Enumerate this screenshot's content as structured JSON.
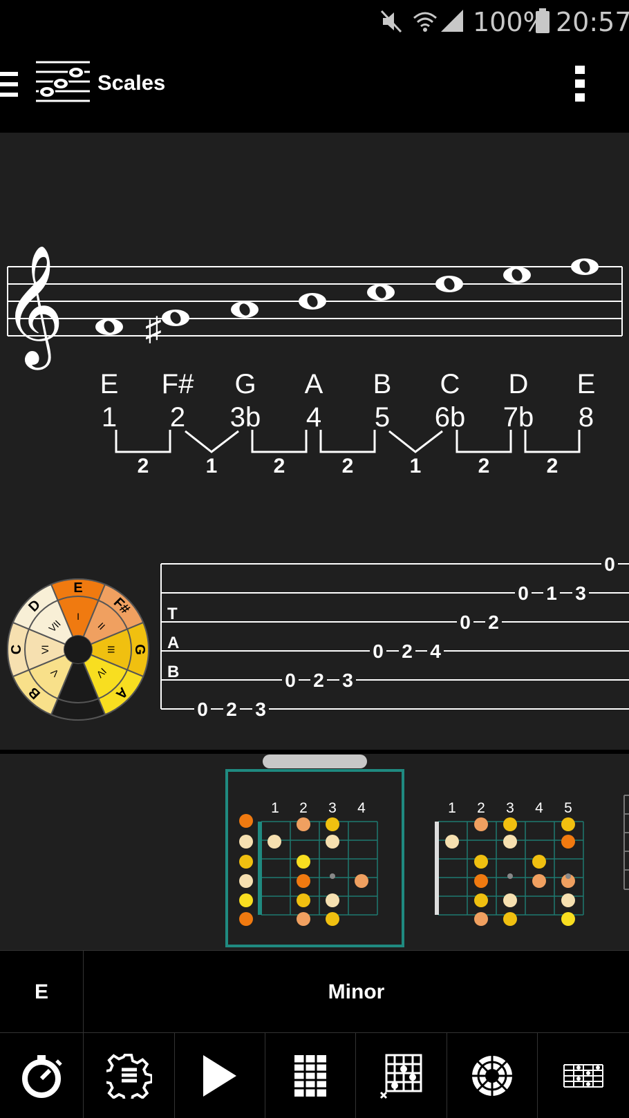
{
  "status": {
    "battery": "100%",
    "time": "20:57"
  },
  "app": {
    "title": "Scales"
  },
  "scale": {
    "notes": [
      "E",
      "F#",
      "G",
      "A",
      "B",
      "C",
      "D",
      "E"
    ],
    "degrees": [
      "1",
      "2",
      "3b",
      "4",
      "5",
      "6b",
      "7b",
      "8"
    ],
    "intervals": [
      "2",
      "1",
      "2",
      "2",
      "1",
      "2",
      "2"
    ],
    "accidental": "♯"
  },
  "wheel": {
    "labels": [
      "E",
      "F#",
      "G",
      "A",
      "",
      "B",
      "C",
      "D"
    ],
    "numerals": [
      "I",
      "II",
      "III",
      "IV",
      "V",
      "VI",
      "VII"
    ]
  },
  "tab": {
    "clef": [
      "T",
      "A",
      "B"
    ],
    "strings": [
      [
        "0"
      ],
      [
        "0",
        "1",
        "3"
      ],
      [
        "0",
        "2"
      ],
      [
        "0",
        "2",
        "4"
      ],
      [
        "0",
        "2",
        "3"
      ],
      [
        "0",
        "2",
        "3"
      ]
    ]
  },
  "fretboards": {
    "first_frets": [
      "1",
      "2",
      "3",
      "4"
    ],
    "second_frets": [
      "1",
      "2",
      "3",
      "4",
      "5"
    ]
  },
  "selector": {
    "root": "E",
    "scale_type": "Minor"
  },
  "colors": {
    "accent_teal": "#1f8a80",
    "note_root": "#f07a10",
    "note_light": "#f6e0b0",
    "note_gold": "#f0c010",
    "note_yellow": "#f8de20",
    "note_salmon": "#f0a060"
  }
}
